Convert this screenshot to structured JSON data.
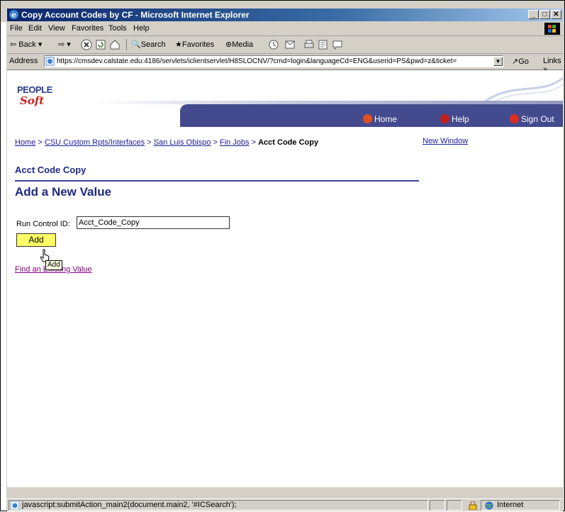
{
  "window": {
    "title": "Copy Account Codes by CF - Microsoft Internet Explorer",
    "minimize": "_",
    "maximize": "□",
    "close": "✕"
  },
  "menu": [
    "File",
    "Edit",
    "View",
    "Favorites",
    "Tools",
    "Help"
  ],
  "toolbar": {
    "back": "Back",
    "search": "Search",
    "favorites": "Favorites",
    "media": "Media"
  },
  "address": {
    "label": "Address",
    "url": "https://cmsdev.calstate.edu:4186/servlets/iclientservlet/H8SLOCNV/?cmd=login&languageCd=ENG&userid=PS&pwd=z&ticket=",
    "go": "Go",
    "links": "Links »"
  },
  "header": {
    "logo_top": "PEOPLE",
    "logo_bottom": "Soft",
    "nav": {
      "home": "Home",
      "help": "Help",
      "signout": "Sign Out"
    }
  },
  "breadcrumb": {
    "items": [
      "Home",
      "CSU Custom Rpts/Interfaces",
      "San Luis Obispo",
      "Fin Jobs"
    ],
    "separator": ">",
    "current": "Acct Code Copy"
  },
  "new_window": "New Window",
  "component_title": "Acct Code Copy",
  "page_title": "Add a New Value",
  "form": {
    "run_control_label": "Run Control ID:",
    "run_control_value": "Acct_Code_Copy",
    "add_button": "Add",
    "find_link": "Find an Existing Value",
    "tooltip": "Add"
  },
  "status": {
    "text": "javascript:submitAction_main2(document.main2, '#ICSearch');",
    "zone": "Internet"
  },
  "colors": {
    "titlebar": "#0a246a",
    "navbar": "#444a8e",
    "heading": "#1e2a82",
    "link": "#1c1c9c",
    "visited": "#800080",
    "add_button": "#ffff66"
  }
}
